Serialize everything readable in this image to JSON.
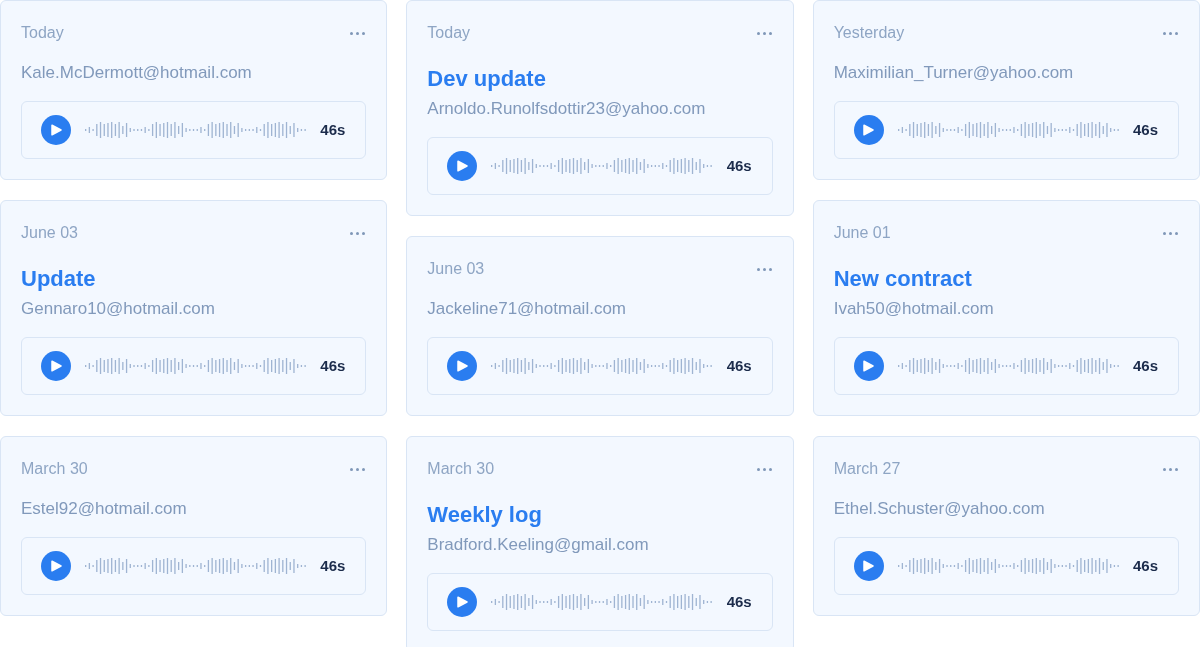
{
  "columns": [
    [
      {
        "date": "Today",
        "email": "Kale.McDermott@hotmail.com",
        "duration": "46s"
      },
      {
        "date": "June 03",
        "title": "Update",
        "email": "Gennaro10@hotmail.com",
        "duration": "46s"
      },
      {
        "date": "March 30",
        "email": "Estel92@hotmail.com",
        "duration": "46s"
      }
    ],
    [
      {
        "date": "Today",
        "title": "Dev update",
        "email": "Arnoldo.Runolfsdottir23@yahoo.com",
        "duration": "46s"
      },
      {
        "date": "June 03",
        "email": "Jackeline71@hotmail.com",
        "duration": "46s"
      },
      {
        "date": "March 30",
        "title": "Weekly log",
        "email": "Bradford.Keeling@gmail.com",
        "duration": "46s"
      }
    ],
    [
      {
        "date": "Yesterday",
        "email": "Maximilian_Turner@yahoo.com",
        "duration": "46s"
      },
      {
        "date": "June 01",
        "title": "New contract",
        "email": "Ivah50@hotmail.com",
        "duration": "46s"
      },
      {
        "date": "March 27",
        "email": "Ethel.Schuster@yahoo.com",
        "duration": "46s"
      }
    ]
  ]
}
